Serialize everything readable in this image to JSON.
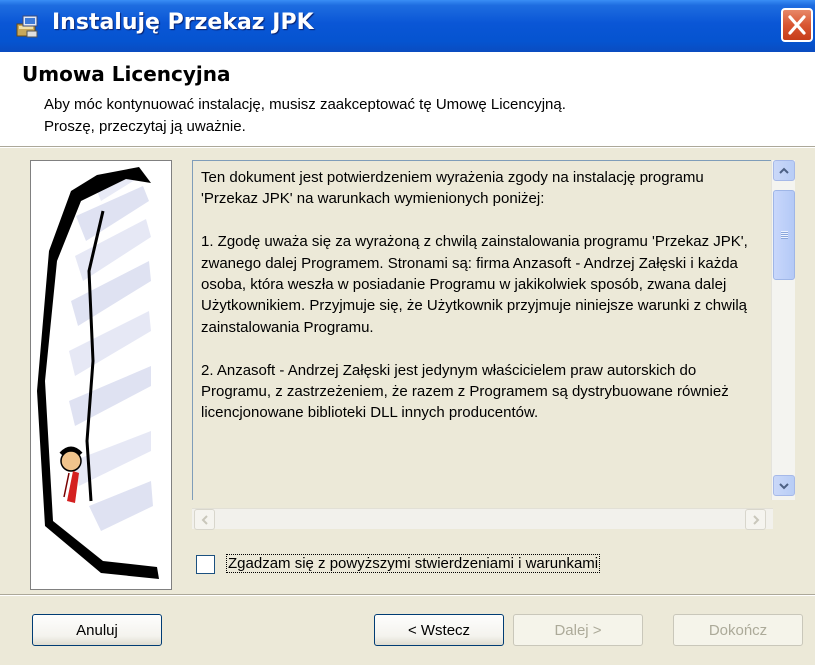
{
  "window": {
    "title": "Instaluję Przekaz JPK",
    "close_icon": "close-icon",
    "app_icon": "installer-icon"
  },
  "header": {
    "title": "Umowa Licencyjna",
    "description_line1": "Aby móc kontynuować instalację, musisz zaakceptować tę Umowę Licencyjną.",
    "description_line2": "Proszę, przeczytaj ją uważnie."
  },
  "license": {
    "paragraphs": [
      "Ten dokument jest potwierdzeniem wyrażenia zgody na instalację programu 'Przekaz JPK' na warunkach wymienionych poniżej:",
      "1. Zgodę uważa się za wyrażoną z chwilą zainstalowania programu 'Przekaz JPK', zwanego dalej Programem. Stronami są: firma Anzasoft - Andrzej Załęski i każda osoba, która weszła w posiadanie Programu w jakikolwiek sposób, zwana dalej Użytkownikiem. Przyjmuje się, że Użytkownik przyjmuje niniejsze warunki z chwilą zainstalowania Programu.",
      "2. Anzasoft - Andrzej Załęski jest jedynym właścicielem praw autorskich do Programu, z zastrzeżeniem, że razem z Programem są dystrybuowane również licencjonowane biblioteki DLL innych producentów."
    ]
  },
  "agree": {
    "label": "Zgadzam się z powyższymi stwierdzeniami i warunkami",
    "checked": false
  },
  "buttons": {
    "cancel": "Anuluj",
    "back": "< Wstecz",
    "next": "Dalej >",
    "finish": "Dokończ"
  }
}
